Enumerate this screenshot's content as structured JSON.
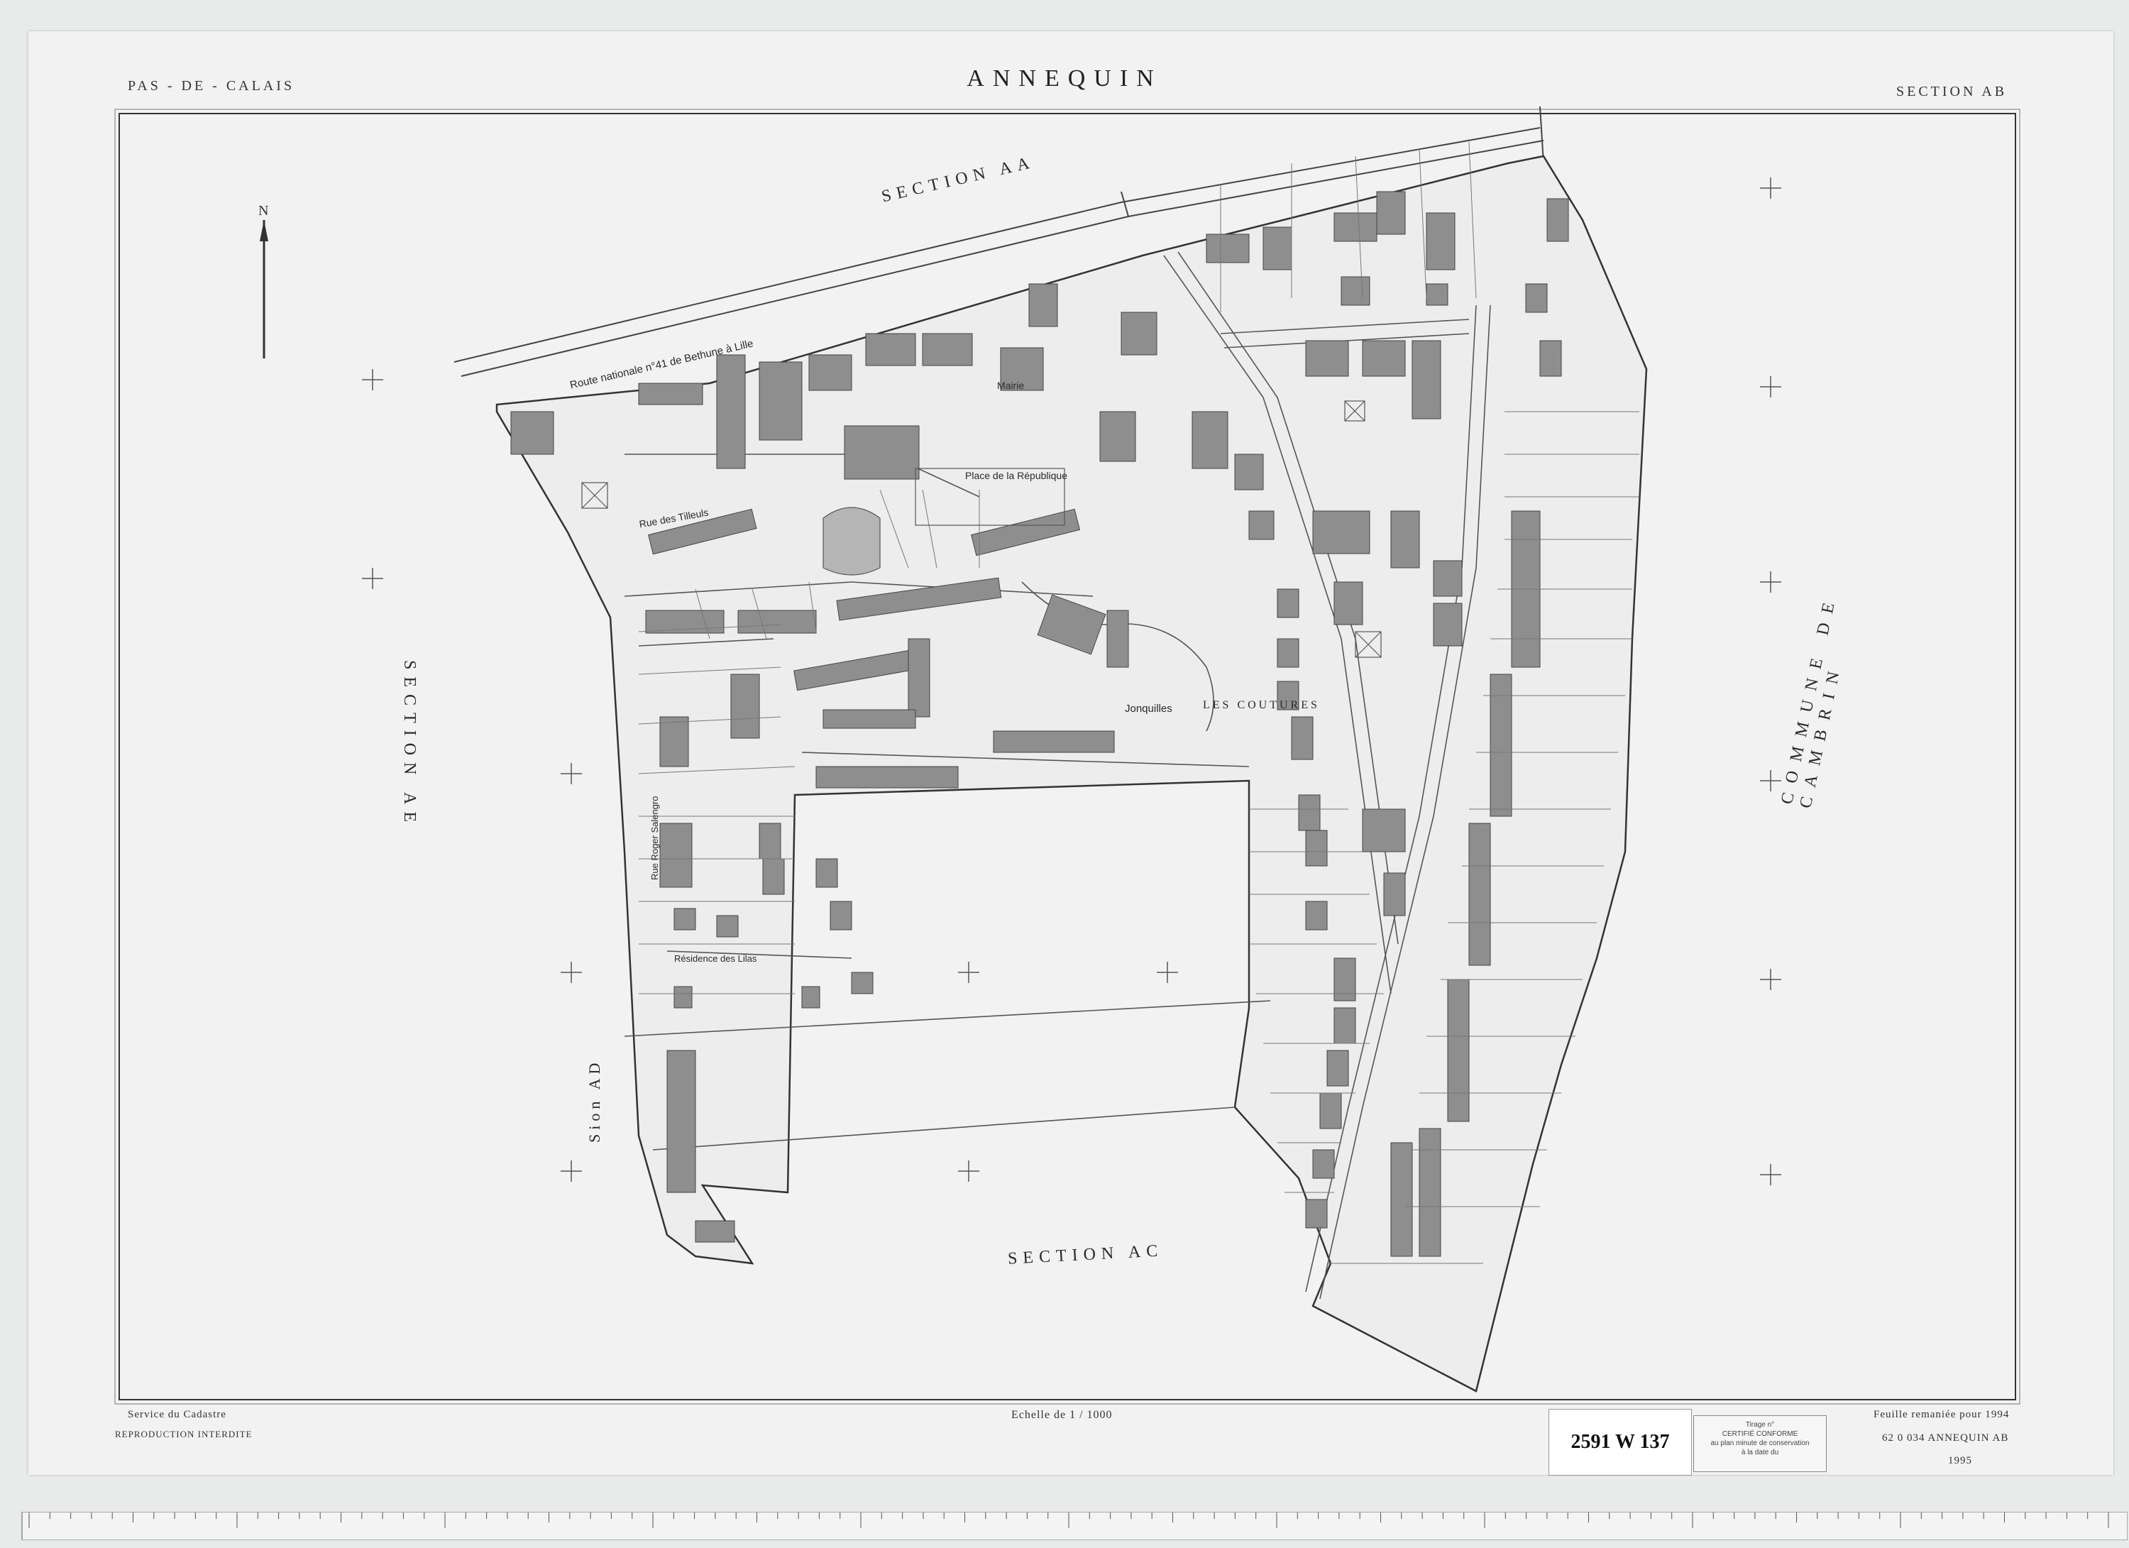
{
  "header": {
    "department": "PAS - DE - CALAIS",
    "commune": "ANNEQUIN",
    "section": "SECTION AB"
  },
  "labels": {
    "section_aa": "SECTION AA",
    "section_ae": "SECTION AE",
    "section_ac": "SECTION AC",
    "section_ad": "Sion AD",
    "commune_de_cambrin": "COMMUNE DE CAMBRIN",
    "route_nationale": "Route nationale n°41 de Bethune à Lille",
    "mairie": "Mairie",
    "place": "Place de la République",
    "rue_tilleuls": "Rue des Tilleuls",
    "jonquilles": "Jonquilles",
    "les_coutures": "LES COUTURES",
    "residence_lilas": "Résidence des Lilas",
    "rue_roger_salengro": "Rue Roger Salengro"
  },
  "footer": {
    "service": "Service du Cadastre",
    "reproduction": "REPRODUCTION INTERDITE",
    "echelle": "Echelle de 1 / 1000",
    "feuille": "Feuille remaniée pour 1994",
    "ref": "62 0 034 ANNEQUIN AB",
    "year": "1995",
    "cote": "2591 W 137",
    "certif_title": "Tirage n°",
    "certif_line1": "CERTIFIÉ CONFORME",
    "certif_line2": "au plan minute de conservation",
    "certif_line3": "à la date du"
  },
  "compass": {
    "label": "N"
  },
  "colors": {
    "paper": "#f1f2f1",
    "building": "#8e8e8e",
    "line": "#555555"
  }
}
